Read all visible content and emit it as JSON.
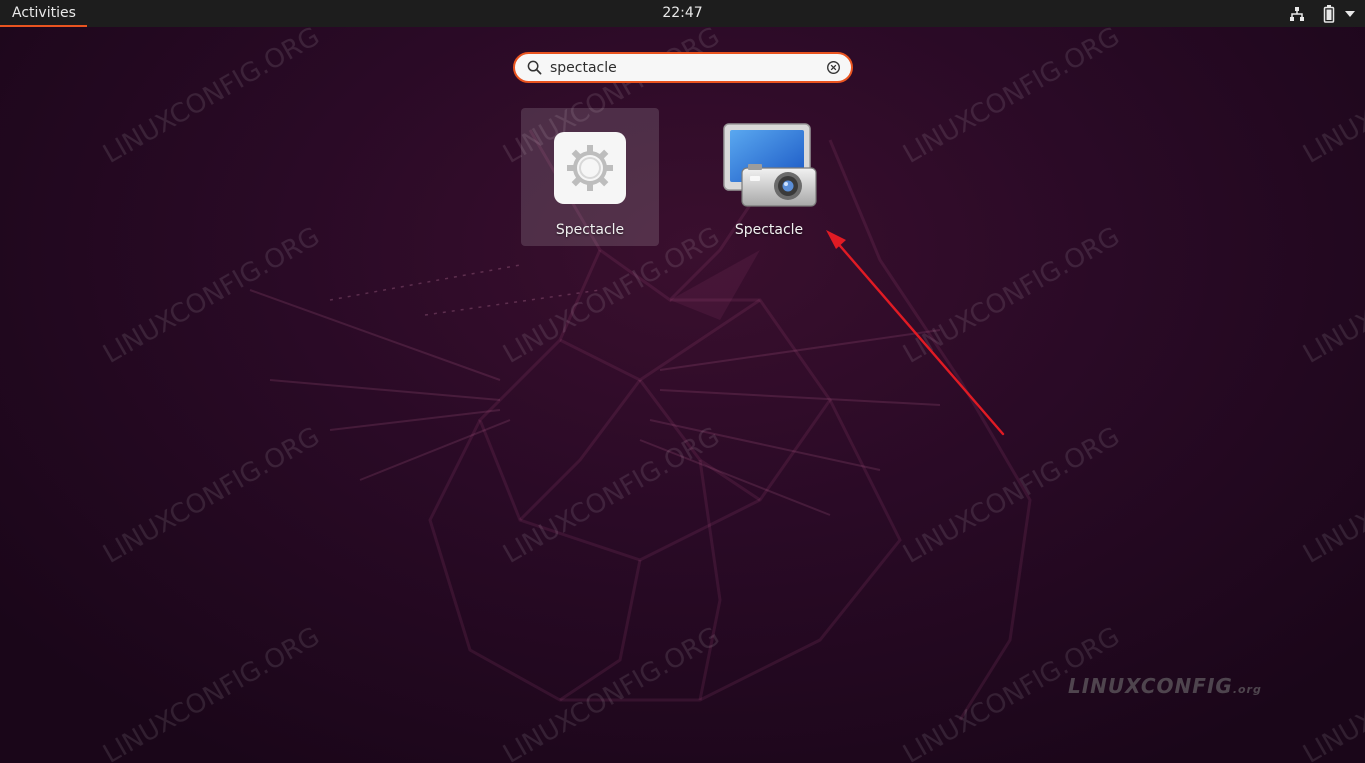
{
  "topbar": {
    "activities_label": "Activities",
    "clock": "22:47",
    "icons": [
      "network-icon",
      "battery-icon",
      "dropdown-arrow-icon"
    ]
  },
  "search": {
    "value": "spectacle",
    "icons": [
      "search-icon",
      "clear-icon"
    ]
  },
  "results": [
    {
      "label": "Spectacle",
      "icon": "gear-icon",
      "selected": true
    },
    {
      "label": "Spectacle",
      "icon": "monitor-camera-icon",
      "selected": false
    }
  ],
  "watermark": {
    "text": "LINUXCONFIG.ORG",
    "logo_main": "LINUXCONFIG",
    "logo_suffix": ".org"
  },
  "colors": {
    "accent": "#e95420",
    "topbar": "#1d1d1d",
    "arrow": "#e01b24"
  }
}
